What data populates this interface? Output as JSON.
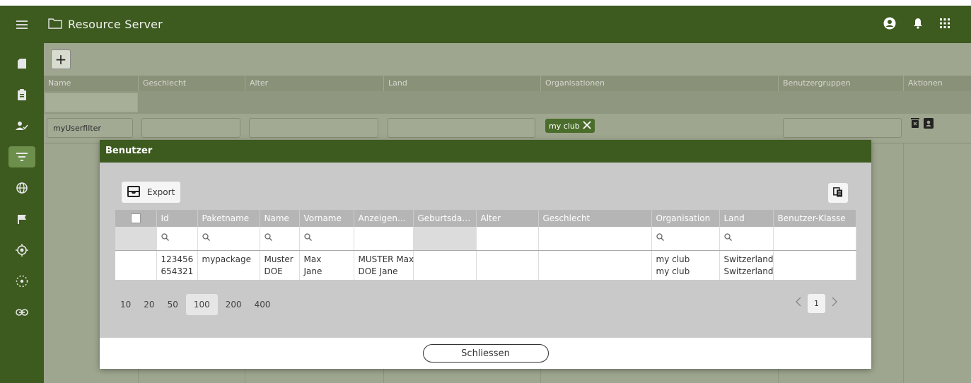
{
  "header": {
    "title": "Resource Server",
    "menu_icon": "hamburger-icon",
    "user_icon": "account-circle-icon",
    "bell_icon": "bell-icon",
    "apps_icon": "apps-grid-icon"
  },
  "colors": {
    "primary": "#3d5a1f",
    "chip": "#4b6d2c",
    "modal_bg": "#c9c9c9",
    "table_header": "#b5b5b5"
  },
  "sidebar": {
    "items": [
      {
        "icon": "sd-card-icon"
      },
      {
        "icon": "clipboard-icon"
      },
      {
        "icon": "user-check-icon"
      },
      {
        "icon": "filter-icon",
        "active": true
      },
      {
        "icon": "globe-icon"
      },
      {
        "icon": "flag-icon"
      },
      {
        "icon": "target-icon"
      },
      {
        "icon": "dotted-circle-icon"
      },
      {
        "icon": "link-icon"
      }
    ]
  },
  "background": {
    "add_label": "+",
    "columns": [
      "Name",
      "Geschlecht",
      "Alter",
      "Land",
      "Organisationen",
      "Benutzergruppen",
      "Aktionen"
    ],
    "row": {
      "name": "myUserfilter",
      "organisation_chip": "my club"
    }
  },
  "modal": {
    "title": "Benutzer",
    "export_label": "Export",
    "columns": [
      "Id",
      "Paketname",
      "Name",
      "Vorname",
      "Anzeigename",
      "Geburtsdatu...",
      "Alter",
      "Geschlecht",
      "Organisation",
      "Land",
      "Benutzer-Klasse"
    ],
    "rows": [
      {
        "id": "123456",
        "paketname": "mypackage",
        "name": "Muster",
        "vorname": "Max",
        "anzeigename": "MUSTER Max",
        "organisation": "my club",
        "land": "Switzerland"
      },
      {
        "id": "654321",
        "paketname": "",
        "name": "DOE",
        "vorname": "Jane",
        "anzeigename": "DOE Jane",
        "organisation": "my club",
        "land": "Switzerland"
      }
    ],
    "page_sizes": [
      "10",
      "20",
      "50",
      "100",
      "200",
      "400"
    ],
    "selected_page_size": "100",
    "current_page": "1",
    "close_label": "Schliessen"
  }
}
